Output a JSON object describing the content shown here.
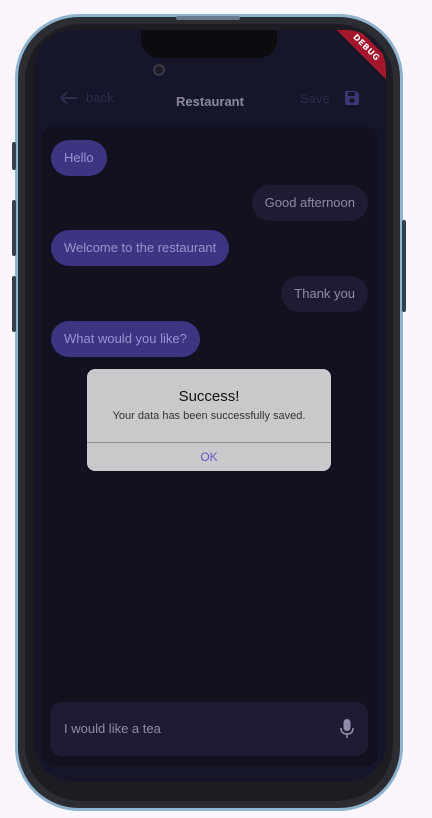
{
  "debug_banner": "DEBUG",
  "appbar": {
    "back_label": "back",
    "title": "Restaurant",
    "save_label": "Save"
  },
  "messages": [
    {
      "from": "bot",
      "text": "Hello"
    },
    {
      "from": "user",
      "text": "Good afternoon"
    },
    {
      "from": "bot",
      "text": "Welcome to the restaurant"
    },
    {
      "from": "user",
      "text": "Thank you"
    },
    {
      "from": "bot",
      "text": "What would you like?"
    }
  ],
  "dialog": {
    "title": "Success!",
    "message": "Your data has been successfully saved.",
    "ok_label": "OK"
  },
  "input": {
    "value": "I would like a tea",
    "icon": "mic-icon"
  },
  "colors": {
    "bot_bubble": "#3c3582",
    "user_bubble": "#1f1b32",
    "accent": "#6a56c6",
    "debug_banner": "#a4162b"
  }
}
